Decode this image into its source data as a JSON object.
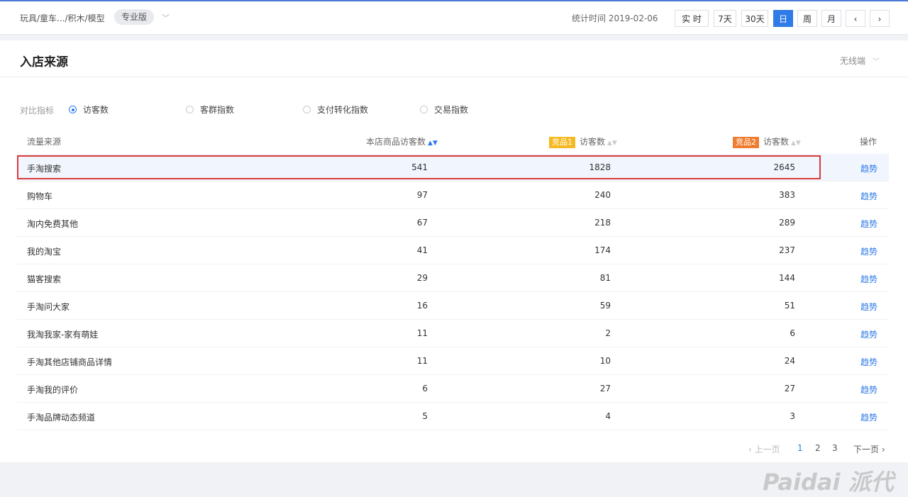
{
  "header": {
    "breadcrumb": "玩具/童车.../积木/模型",
    "edition_badge": "专业版",
    "stat_time": "统计时间 2019-02-06",
    "range_buttons": [
      "实 时",
      "7天",
      "30天",
      "日",
      "周",
      "月"
    ],
    "active_range": "日",
    "prev_icon": "‹",
    "next_icon": "›"
  },
  "panel": {
    "title": "入店来源",
    "device_select": "无线端"
  },
  "metrics": {
    "label": "对比指标",
    "options": [
      "访客数",
      "客群指数",
      "支付转化指数",
      "交易指数"
    ],
    "selected": "访客数"
  },
  "table": {
    "headers": {
      "source": "流量来源",
      "own": "本店商品访客数",
      "comp1_tag": "竞品1",
      "comp1": "访客数",
      "comp2_tag": "竞品2",
      "comp2": "访客数",
      "action": "操作"
    },
    "rows": [
      {
        "source": "手淘搜索",
        "own": "541",
        "comp1": "1828",
        "comp2": "2645",
        "action": "趋势"
      },
      {
        "source": "购物车",
        "own": "97",
        "comp1": "240",
        "comp2": "383",
        "action": "趋势"
      },
      {
        "source": "淘内免费其他",
        "own": "67",
        "comp1": "218",
        "comp2": "289",
        "action": "趋势"
      },
      {
        "source": "我的淘宝",
        "own": "41",
        "comp1": "174",
        "comp2": "237",
        "action": "趋势"
      },
      {
        "source": "猫客搜索",
        "own": "29",
        "comp1": "81",
        "comp2": "144",
        "action": "趋势"
      },
      {
        "source": "手淘问大家",
        "own": "16",
        "comp1": "59",
        "comp2": "51",
        "action": "趋势"
      },
      {
        "source": "我淘我家-家有萌娃",
        "own": "11",
        "comp1": "2",
        "comp2": "6",
        "action": "趋势"
      },
      {
        "source": "手淘其他店铺商品详情",
        "own": "11",
        "comp1": "10",
        "comp2": "24",
        "action": "趋势"
      },
      {
        "source": "手淘我的评价",
        "own": "6",
        "comp1": "27",
        "comp2": "27",
        "action": "趋势"
      },
      {
        "source": "手淘品牌动态频道",
        "own": "5",
        "comp1": "4",
        "comp2": "3",
        "action": "趋势"
      }
    ]
  },
  "pagination": {
    "prev": "‹ 上一页",
    "pages": [
      "1",
      "2",
      "3"
    ],
    "current": "1",
    "next": "下一页 ›"
  },
  "watermark": "Paidai 派代",
  "colors": {
    "accent": "#2f7be8",
    "comp1_tag": "#f5b922",
    "comp2_tag": "#ef7d31",
    "highlight_border": "#d93b3b"
  }
}
